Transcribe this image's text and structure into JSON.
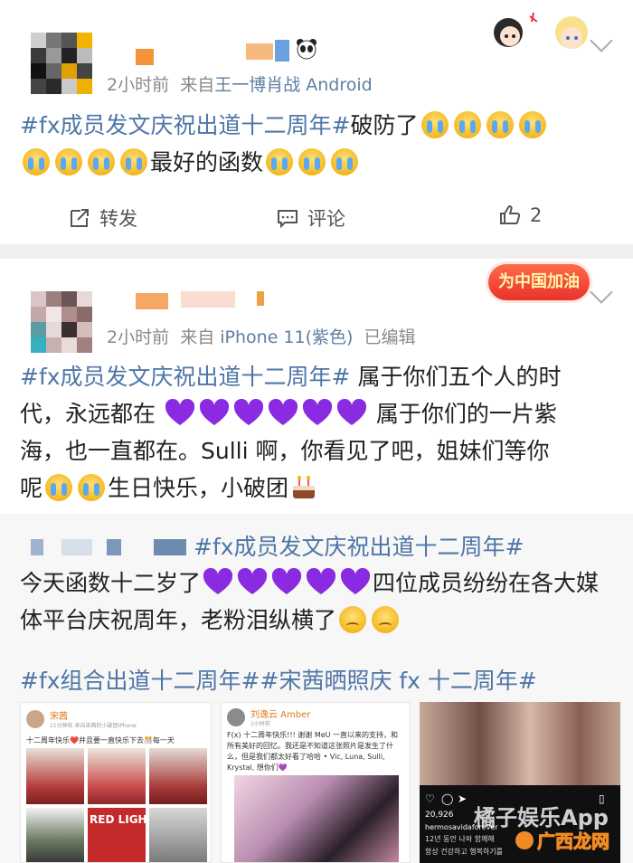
{
  "post1": {
    "meta_time": "2小时前",
    "meta_from": "来自",
    "meta_source": "王一博肖战 Android",
    "hashtag": "#fx成员发文庆祝出道十二周年#",
    "text_a": "破防了",
    "text_b": "最好的函数",
    "actions": {
      "repost": "转发",
      "comment": "评论",
      "like_count": "2"
    }
  },
  "post2": {
    "meta_time": "2小时前",
    "meta_from": "来自",
    "meta_source": "iPhone 11(紫色)",
    "meta_edited": "已编辑",
    "badge": "为中国加油",
    "hashtag": "#fx成员发文庆祝出道十二周年#",
    "line1": "属于你们五个人的时",
    "line2a": "代，永远都在",
    "line2b": "属于你们的一片紫",
    "line3": "海，也一直都在。Sulli 啊，你看见了吧，姐妹们等你",
    "line4a": "呢",
    "line4b": "生日快乐，小破团"
  },
  "repost": {
    "hashtag": "#fx成员发文庆祝出道十二周年#",
    "line1a": "今天函数十二岁了",
    "line1b": "四位成员纷纷在各大媒",
    "line2": "体平台庆祝周年，老粉泪纵横了",
    "tags_line": "#fx组合出道十二周年##宋茜晒照庆 fx 十二周年#"
  },
  "thumb1": {
    "name": "宋茜",
    "sub": "11分钟前 来自宋茜的小破团iPhone",
    "caption": "十二周年快乐❤️并且要一直快乐下去🎊每一天",
    "poster": "RED LIGHT"
  },
  "thumb2": {
    "name": "刘逸云 Amber",
    "sub": "1小时前",
    "caption": "F(x) 十二周年快乐!!! 谢谢 MeU 一直以来的支持，和所有美好的回忆。我还是不知道这张照片是发生了什么，但是我们都太好看了哈哈 • Vic, Luna, Sulli, Krystal, 想你们💜"
  },
  "thumb3": {
    "likes": "20,926",
    "user": "hermosavidaforever",
    "caption1": "12년 동안 나와 함께해",
    "caption2": "항상 건강하고 행복하기를"
  },
  "watermark": {
    "line1": "橘子娱乐App",
    "line2": "广西龙网"
  },
  "colors": {
    "hashtag": "#4e76a6",
    "source": "#5d7fa3",
    "purple": "#8a2be2",
    "orange": "#f08a24"
  }
}
